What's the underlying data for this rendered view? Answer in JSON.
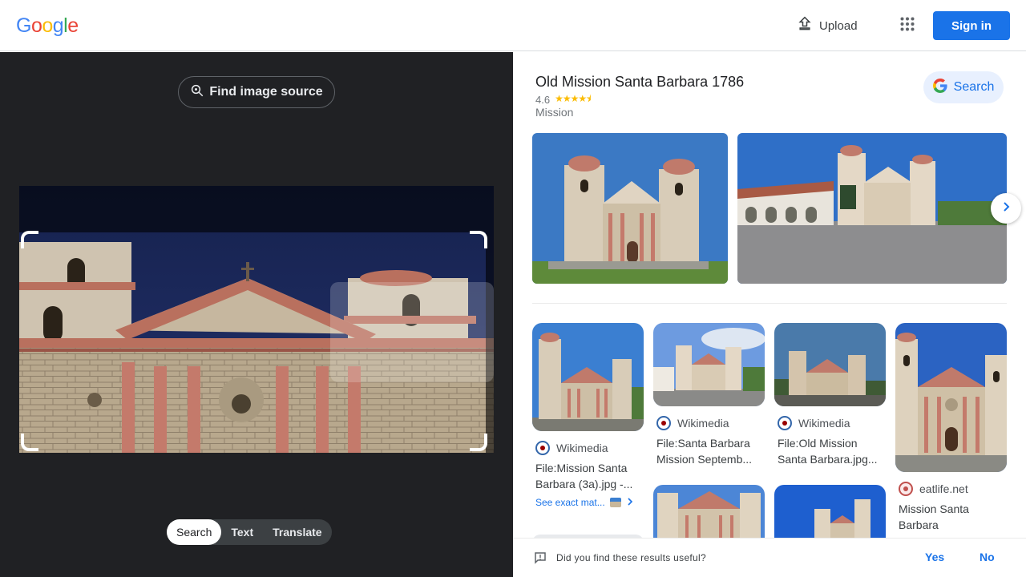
{
  "header": {
    "logo_letters": [
      {
        "char": "G",
        "color": "#4285f4"
      },
      {
        "char": "o",
        "color": "#ea4335"
      },
      {
        "char": "o",
        "color": "#fbbc05"
      },
      {
        "char": "g",
        "color": "#4285f4"
      },
      {
        "char": "l",
        "color": "#34a853"
      },
      {
        "char": "e",
        "color": "#ea4335"
      }
    ],
    "upload_label": "Upload",
    "signin_label": "Sign in",
    "accent": "#1a73e8"
  },
  "lens": {
    "find_source_label": "Find image source",
    "tabs": [
      {
        "label": "Search",
        "active": true
      },
      {
        "label": "Text",
        "active": false
      },
      {
        "label": "Translate",
        "active": false
      }
    ]
  },
  "knowledge_panel": {
    "title": "Old Mission Santa Barbara 1786",
    "rating": "4.6",
    "stars": "★★★★⯨",
    "type": "Mission",
    "search_label": "Search"
  },
  "results": [
    {
      "source": "Wikimedia",
      "title": "File:Mission Santa Barbara (3a).jpg -...",
      "see_exact": "See exact mat..."
    },
    {
      "source": "Wikimedia",
      "title": "File:Santa Barbara Mission Septemb..."
    },
    {
      "source": "Wikimedia",
      "title": "File:Old Mission Santa Barbara.jpg..."
    },
    {
      "source": "eatlife.net",
      "title": "Mission Santa Barbara"
    }
  ],
  "feedback": {
    "question": "Did you find these results useful?",
    "yes": "Yes",
    "no": "No"
  }
}
